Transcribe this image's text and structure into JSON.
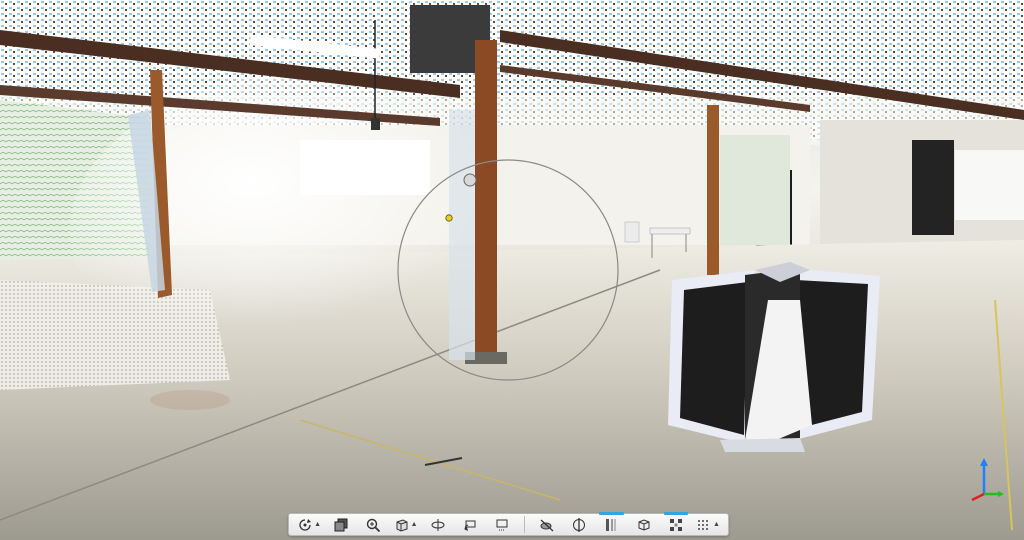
{
  "viewport": {
    "scene": "point-cloud-warehouse"
  },
  "orbit_gizmo": {
    "visible": true
  },
  "scanner_model": {
    "visible": true
  },
  "toolbar": {
    "tools": [
      {
        "icon": "orbit-icon",
        "has_dropdown": true,
        "active": false
      },
      {
        "icon": "pan-icon",
        "has_dropdown": false,
        "active": false
      },
      {
        "icon": "zoom-icon",
        "has_dropdown": false,
        "active": false
      },
      {
        "icon": "view-cube-icon",
        "has_dropdown": true,
        "active": false
      },
      {
        "icon": "look-around-icon",
        "has_dropdown": false,
        "active": false
      },
      {
        "icon": "undo-view-icon",
        "has_dropdown": false,
        "active": false
      },
      {
        "icon": "fit-view-icon",
        "has_dropdown": false,
        "active": false
      },
      {
        "icon": "hide-scan-icon",
        "has_dropdown": false,
        "active": false
      },
      {
        "icon": "section-plane-icon",
        "has_dropdown": false,
        "active": false
      },
      {
        "icon": "limit-box-icon",
        "has_dropdown": false,
        "active": true
      },
      {
        "icon": "clip-box-icon",
        "has_dropdown": false,
        "active": false
      },
      {
        "icon": "scan-locations-icon",
        "has_dropdown": false,
        "active": true
      },
      {
        "icon": "point-display-icon",
        "has_dropdown": true,
        "active": false
      }
    ]
  },
  "axis_triad": {
    "x_color": "#e02020",
    "y_color": "#20c020",
    "z_color": "#2080ff"
  },
  "colors": {
    "toolbar_accent": "#37a3dc",
    "steel_beam": "#4a2e22",
    "wood_column": "#9b5a2c"
  }
}
